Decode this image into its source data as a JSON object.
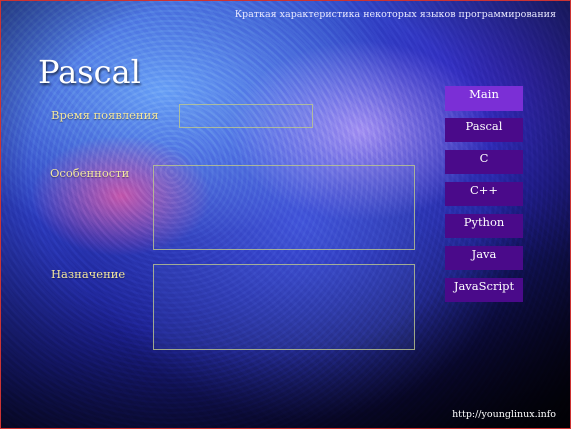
{
  "header": {
    "subtitle": "Краткая характеристика некоторых языков программирования"
  },
  "page": {
    "title": "Pascal"
  },
  "form": {
    "appearance_label": "Время появления",
    "appearance_value": "",
    "features_label": "Особенности",
    "features_value": "",
    "purpose_label": "Назначение",
    "purpose_value": ""
  },
  "nav": {
    "items": [
      {
        "label": "Main",
        "active": true
      },
      {
        "label": "Pascal",
        "active": false
      },
      {
        "label": "C",
        "active": false
      },
      {
        "label": "C++",
        "active": false
      },
      {
        "label": "Python",
        "active": false
      },
      {
        "label": "Java",
        "active": false
      },
      {
        "label": "JavaScript",
        "active": false
      }
    ]
  },
  "footer": {
    "link": "http://younglinux.info"
  },
  "colors": {
    "nav_bg": "#4a0a8a",
    "nav_active_bg": "#7b2fd6",
    "label_text": "#f3e7a0",
    "field_border": "#bec88c"
  }
}
